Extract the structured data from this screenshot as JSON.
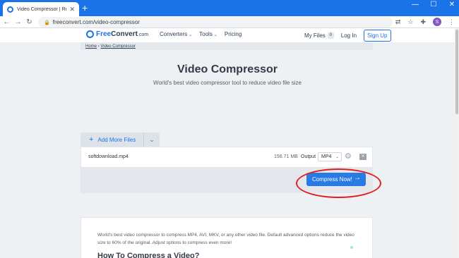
{
  "browser": {
    "tab_title": "Video Compressor | Reduce Vide",
    "tab_close": "✕",
    "new_tab": "+",
    "url": "freeconvert.com/video-compressor",
    "profile_initial": "S"
  },
  "header": {
    "logo_free": "Free",
    "logo_convert": "Convert",
    "logo_suffix": ".com",
    "nav": [
      "Converters",
      "Tools",
      "Pricing"
    ],
    "my_files_label": "My Files",
    "my_files_count": "0",
    "login_label": "Log In",
    "signup_label": "Sign Up"
  },
  "breadcrumb": {
    "home": "Home",
    "separator": "›",
    "current": "Video Compressor"
  },
  "hero": {
    "title": "Video Compressor",
    "subtitle": "World's best video compressor tool to reduce video file size"
  },
  "uploader": {
    "add_files_label": "Add More Files",
    "file": {
      "name": "softdownload.mp4",
      "size": "158.71 MB",
      "output_label": "Output",
      "format": "MP4"
    },
    "compress_label": "Compress Now!"
  },
  "content": {
    "paragraph": "World's best video compressor to compress MP4, AVI, MKV, or any other video file. Default advanced options reduce the video size to 60% of the original. Adjust options to compress even more!",
    "heading": "How To Compress a Video?"
  },
  "colors": {
    "accent": "#1a73e8",
    "highlight": "#e02020"
  }
}
